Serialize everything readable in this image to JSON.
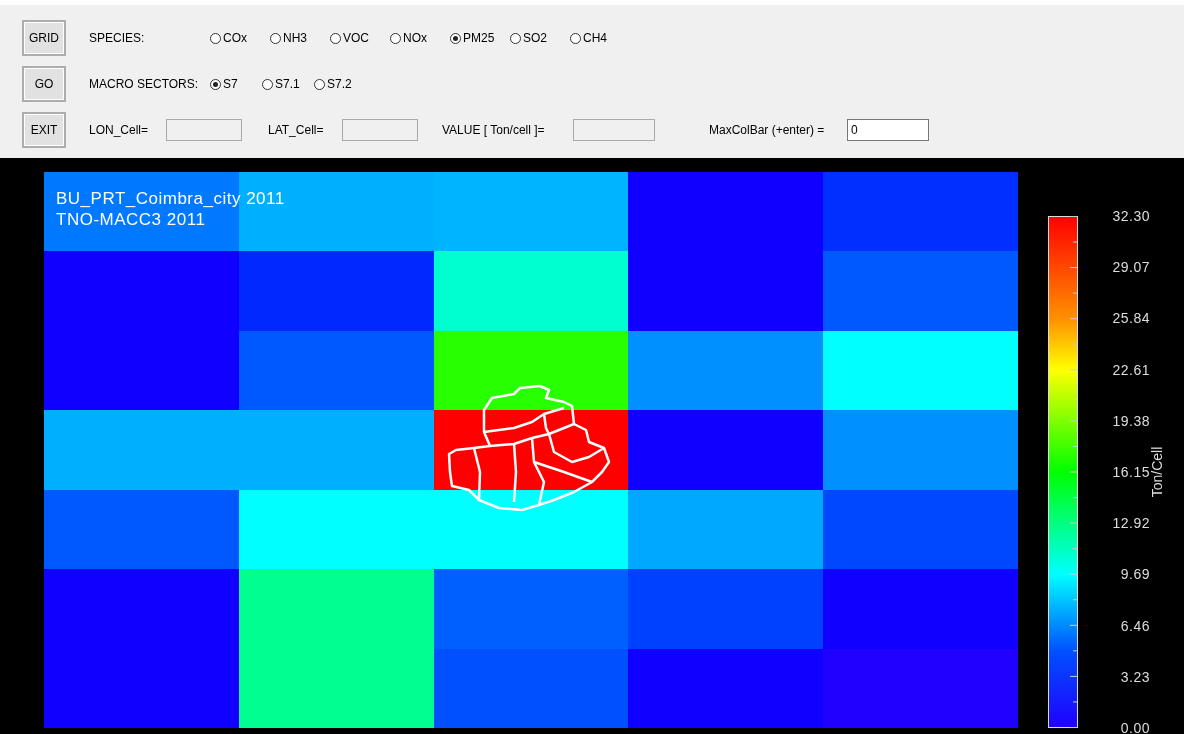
{
  "buttons": [
    {
      "label": "GRID"
    },
    {
      "label": "GO"
    },
    {
      "label": "EXIT"
    }
  ],
  "species": {
    "label": "SPECIES:",
    "options": [
      {
        "label": "COx",
        "selected": false
      },
      {
        "label": "NH3",
        "selected": false
      },
      {
        "label": "VOC",
        "selected": false
      },
      {
        "label": "NOx",
        "selected": false
      },
      {
        "label": "PM25",
        "selected": true
      },
      {
        "label": "SO2",
        "selected": false
      },
      {
        "label": "CH4",
        "selected": false
      }
    ]
  },
  "macro_sectors": {
    "label": "MACRO SECTORS:",
    "options": [
      {
        "label": "S7",
        "selected": true
      },
      {
        "label": "S7.1",
        "selected": false
      },
      {
        "label": "S7.2",
        "selected": false
      }
    ]
  },
  "fields": [
    {
      "label": "LON_Cell="
    },
    {
      "label": "LAT_Cell="
    },
    {
      "label": "VALUE [ Ton/cell ]="
    },
    {
      "label": "MaxColBar (+enter) =",
      "value": "0"
    }
  ],
  "map": {
    "titles": [
      "BU_PRT_Coimbra_city 2011",
      "TNO-MACC3 2011"
    ],
    "rows": [
      [
        {
          "color": "#0078ff"
        },
        {
          "color": "#00b0ff"
        },
        {
          "color": "#00b4ff"
        },
        {
          "color": "#1000ff"
        },
        {
          "color": "#0030ff"
        }
      ],
      [
        {
          "color": "#1000ff"
        },
        {
          "color": "#0028ff"
        },
        {
          "color": "#00ffd0"
        },
        {
          "color": "#1000ff"
        },
        {
          "color": "#0058ff"
        }
      ],
      [
        {
          "color": "#1000ff"
        },
        {
          "color": "#0058ff"
        },
        {
          "color": "#28ff00"
        },
        {
          "color": "#0090ff"
        },
        {
          "color": "#00ffff"
        }
      ],
      [
        {
          "color": "#00b0ff"
        },
        {
          "color": "#00b0ff"
        },
        {
          "color": "#ff0000"
        },
        {
          "color": "#1000ff"
        },
        {
          "color": "#0090ff"
        }
      ],
      [
        {
          "color": "#0058ff"
        },
        {
          "color": "#00ffff"
        },
        {
          "color": "#00ffff"
        },
        {
          "color": "#00a8ff"
        },
        {
          "color": "#0048ff"
        }
      ],
      [
        {
          "color": "#1000ff"
        },
        {
          "color": "#00ff90"
        },
        {
          "color": "#0060ff"
        },
        {
          "color": "#0040ff"
        },
        {
          "color": "#1000ff"
        }
      ],
      [
        {
          "color": "#1000ff"
        },
        {
          "color": "#00ff90"
        },
        {
          "color": "#0050ff"
        },
        {
          "color": "#1000ff"
        },
        {
          "color": "#2000ff"
        }
      ]
    ]
  },
  "colorbar": {
    "unit": "Ton/Cell",
    "ticks": [
      "32.30",
      "29.07",
      "25.84",
      "22.61",
      "19.38",
      "16.15",
      "12.92",
      "9.69",
      "6.46",
      "3.23",
      "0.00"
    ]
  }
}
